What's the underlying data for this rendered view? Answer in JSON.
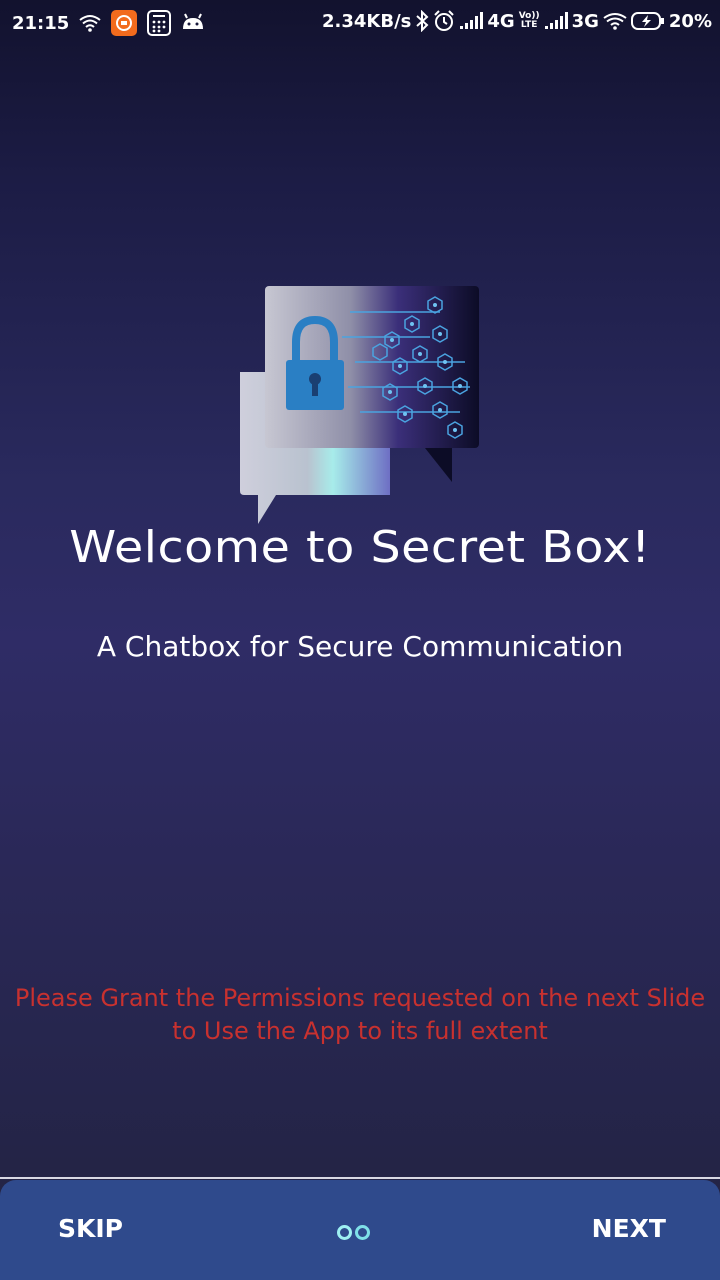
{
  "status_bar": {
    "time": "21:15",
    "network_speed": "2.34KB/s",
    "network_4g": "4G",
    "volte_top": "Vo))",
    "volte_bottom": "LTE",
    "network_3g": "3G",
    "battery": "20%",
    "icons": [
      "wifi-icon",
      "mi-app-icon",
      "calculator-icon",
      "android-icon",
      "bluetooth-icon",
      "alarm-icon",
      "signal-icon",
      "signal-icon",
      "wifi-icon",
      "battery-charging-icon"
    ]
  },
  "intro": {
    "title": "Welcome to Secret Box!",
    "subtitle": "A Chatbox for Secure Communication",
    "warning_line1": "Please Grant the Permissions requested on the next Slide",
    "warning_line2": "to Use the App to its full extent"
  },
  "navigation": {
    "skip_label": "SKIP",
    "next_label": "NEXT",
    "total_slides": 2,
    "current_slide": 1
  },
  "colors": {
    "warning_text": "#c8312f",
    "bottom_bar": "#2f4a8c",
    "dot_indicator": "#7fe0e8",
    "lock_icon": "#2a7fc4"
  }
}
